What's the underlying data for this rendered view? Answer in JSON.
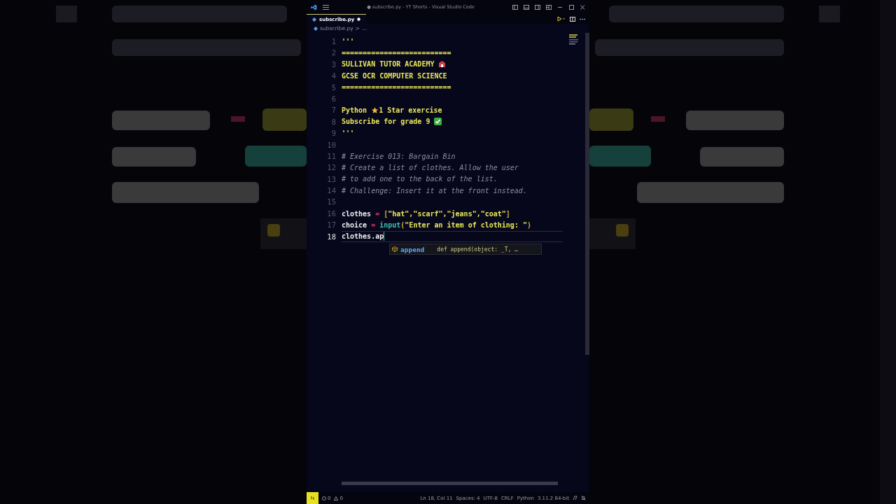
{
  "window": {
    "title": "● subscribe.py - YT Shorts - Visual Studio Code"
  },
  "tabs": [
    {
      "label": "subscribe.py",
      "selected": true,
      "modified": true
    }
  ],
  "breadcrumb": [
    "subscribe.py",
    ">",
    "..."
  ],
  "editor": {
    "lines": [
      {
        "number": "1",
        "current": false,
        "tokens": [
          {
            "text": "'''",
            "kind": "doc"
          }
        ]
      },
      {
        "number": "2",
        "current": false,
        "tokens": [
          {
            "text": "==========================",
            "kind": "doc"
          }
        ]
      },
      {
        "number": "3",
        "current": false,
        "tokens": [
          {
            "text": "SULLIVAN TUTOR ACADEMY ",
            "kind": "doc"
          },
          {
            "kind": "school"
          }
        ]
      },
      {
        "number": "4",
        "current": false,
        "tokens": [
          {
            "text": "GCSE OCR COMPUTER SCIENCE",
            "kind": "doc"
          }
        ]
      },
      {
        "number": "5",
        "current": false,
        "tokens": [
          {
            "text": "==========================",
            "kind": "doc"
          }
        ]
      },
      {
        "number": "6",
        "current": false
      },
      {
        "number": "7",
        "current": false,
        "tokens": [
          {
            "text": "Python ",
            "kind": "doc"
          },
          {
            "kind": "star"
          },
          {
            "text": "1 Star exercise",
            "kind": "doc"
          }
        ]
      },
      {
        "number": "8",
        "current": false,
        "tokens": [
          {
            "text": "Subscribe for grade 9 ",
            "kind": "doc"
          },
          {
            "kind": "check"
          }
        ]
      },
      {
        "number": "9",
        "current": false,
        "tokens": [
          {
            "text": "'''",
            "kind": "doc"
          }
        ]
      },
      {
        "number": "10",
        "current": false
      },
      {
        "number": "11",
        "current": false,
        "tokens": [
          {
            "text": "# Exercise 013: Bargain Bin",
            "kind": "comment"
          }
        ]
      },
      {
        "number": "12",
        "current": false,
        "tokens": [
          {
            "text": "# Create a list of clothes. Allow the user",
            "kind": "comment"
          }
        ]
      },
      {
        "number": "13",
        "current": false,
        "tokens": [
          {
            "text": "# to add one to the back of the list.",
            "kind": "comment"
          }
        ]
      },
      {
        "number": "14",
        "current": false,
        "tokens": [
          {
            "text": "# Challenge: Insert it at the front instead.",
            "kind": "comment"
          }
        ]
      },
      {
        "number": "15",
        "current": false
      },
      {
        "number": "16",
        "current": false,
        "tokens": [
          {
            "text": "clothes ",
            "kind": "plain"
          },
          {
            "text": "=",
            "kind": "operator"
          },
          {
            "text": " [",
            "kind": "bracket"
          },
          {
            "text": "\"hat\",\"scarf\",\"jeans\",\"coat\"",
            "kind": "string"
          },
          {
            "text": "]",
            "kind": "bracket"
          }
        ]
      },
      {
        "number": "17",
        "current": false,
        "tokens": [
          {
            "text": "choice ",
            "kind": "plain"
          },
          {
            "text": "=",
            "kind": "operator"
          },
          {
            "text": " input",
            "kind": "function"
          },
          {
            "text": "(",
            "kind": "bracket"
          },
          {
            "text": "\"Enter an item of clothing: \"",
            "kind": "string"
          },
          {
            "text": ")",
            "kind": "bracket"
          }
        ]
      },
      {
        "number": "18",
        "current": true,
        "tokens": [
          {
            "text": "clothes.ap",
            "kind": "plain"
          }
        ]
      }
    ]
  },
  "suggestion": {
    "match": "ap",
    "rest": "pend",
    "detail": "def append(object: _T, …"
  },
  "status_bar": {
    "errors": "0",
    "warnings": "0",
    "items": [
      "Ln 18, Col 11",
      "Spaces: 4",
      "UTF-8",
      "CRLF",
      "Python",
      "3.11.2 64-bit"
    ]
  }
}
